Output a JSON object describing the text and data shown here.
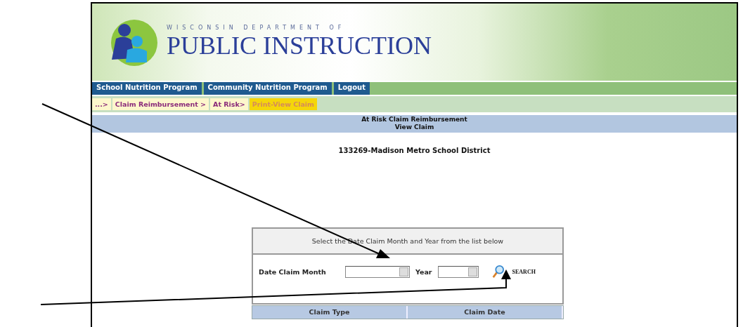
{
  "header": {
    "logo_small": "WISCONSIN DEPARTMENT OF",
    "logo_title": "PUBLIC INSTRUCTION"
  },
  "nav_tabs": [
    {
      "label": "School Nutrition Program"
    },
    {
      "label": "Community Nutrition Program"
    },
    {
      "label": "Logout"
    }
  ],
  "breadcrumb": [
    {
      "label": "...>",
      "selected": false
    },
    {
      "label": "Claim Reimbursement >",
      "selected": false
    },
    {
      "label": "At Risk>",
      "selected": false
    },
    {
      "label": "Print-View Claim",
      "selected": true
    }
  ],
  "title_bar": {
    "title": "At Risk Claim Reimbursement",
    "subtitle": "View Claim"
  },
  "district": "133269-Madison Metro School District",
  "search_panel": {
    "instruction": "Select the Date Claim Month and Year from the list below",
    "month_label": "Date Claim Month",
    "year_label": "Year",
    "search": "SEARCH"
  },
  "table": {
    "columns": [
      "Claim Type",
      "Claim Date"
    ]
  }
}
